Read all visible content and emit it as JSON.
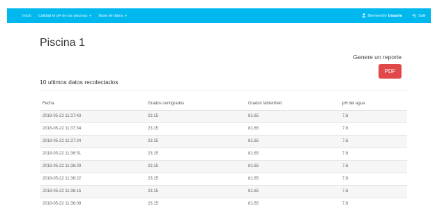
{
  "navbar": {
    "brand": "Inicio",
    "menus": [
      {
        "label": "Calidad el pH de las piscinas"
      },
      {
        "label": "Base de datos"
      }
    ],
    "user_prefix": "Bienvenido",
    "user_name": "Usuario",
    "exit_label": "Salir",
    "background_color": "#00b7ee"
  },
  "page": {
    "title": "Piscina 1",
    "report_label": "Genere un reporte",
    "pdf_button": "PDF",
    "pdf_color": "#e1484a",
    "section_title": "10 ultimos datos recolectados"
  },
  "table": {
    "headers": [
      "Fecha",
      "Grados centigrados",
      "Grados fahrenheit",
      "pH del agua"
    ],
    "rows": [
      [
        "2018-05-22 11:37:43",
        "23.15",
        "81.65",
        "7.6"
      ],
      [
        "2018-05-22 11:37:34",
        "23.15",
        "81.65",
        "7.6"
      ],
      [
        "2018-05-22 11:37:24",
        "23.15",
        "81.65",
        "7.6"
      ],
      [
        "2018-05-22 11:36:51",
        "23.15",
        "81.65",
        "7.6"
      ],
      [
        "2018-05-22 11:36:29",
        "23.15",
        "81.65",
        "7.6"
      ],
      [
        "2018-05-22 11:36:22",
        "23.15",
        "81.65",
        "7.6"
      ],
      [
        "2018-05-22 11:36:15",
        "23.15",
        "81.65",
        "7.6"
      ],
      [
        "2018-05-22 11:36:09",
        "23.15",
        "81.65",
        "7.6"
      ]
    ]
  }
}
